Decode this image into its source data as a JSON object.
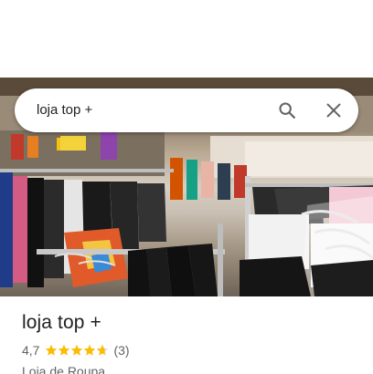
{
  "search": {
    "value": "loja top +",
    "search_icon": "search-icon",
    "close_icon": "close-icon"
  },
  "place": {
    "photo_alt": "store-photo",
    "name": "loja top +",
    "rating": "4,7",
    "rating_value": 4.7,
    "stars_max": 5,
    "review_count": "(3)",
    "category": "Loja de Roupa"
  },
  "colors": {
    "star": "#fbbc04",
    "star_empty": "#dadce0",
    "text_primary": "#202124",
    "text_secondary": "#5f6368"
  }
}
